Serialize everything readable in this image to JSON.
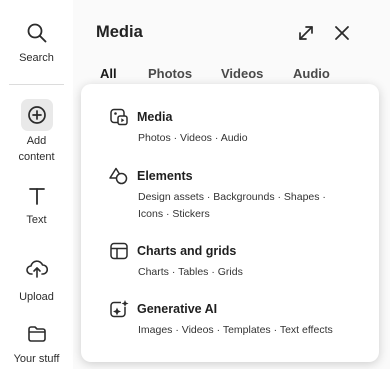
{
  "rail": {
    "items": [
      {
        "label": "Search",
        "icon": "search-icon"
      },
      {
        "label": "Add content",
        "icon": "plus-circle-icon"
      },
      {
        "label": "Text",
        "icon": "text-icon"
      },
      {
        "label": "Upload",
        "icon": "upload-cloud-icon"
      },
      {
        "label": "Your stuff",
        "icon": "folder-icon"
      }
    ]
  },
  "panel": {
    "title": "Media",
    "tabs": [
      "All",
      "Photos",
      "Videos",
      "Audio"
    ],
    "active_tab": "All"
  },
  "menu": {
    "options": [
      {
        "title": "Media",
        "subtitle": "Photos · Videos · Audio",
        "icon": "media-icon"
      },
      {
        "title": "Elements",
        "subtitle": "Design assets · Backgrounds · Shapes · Icons · Stickers",
        "icon": "shapes-icon"
      },
      {
        "title": "Charts and grids",
        "subtitle": "Charts · Tables · Grids",
        "icon": "grid-layout-icon"
      },
      {
        "title": "Generative AI",
        "subtitle": "Images · Videos · Templates · Text effects",
        "icon": "sparkle-icon"
      }
    ]
  }
}
